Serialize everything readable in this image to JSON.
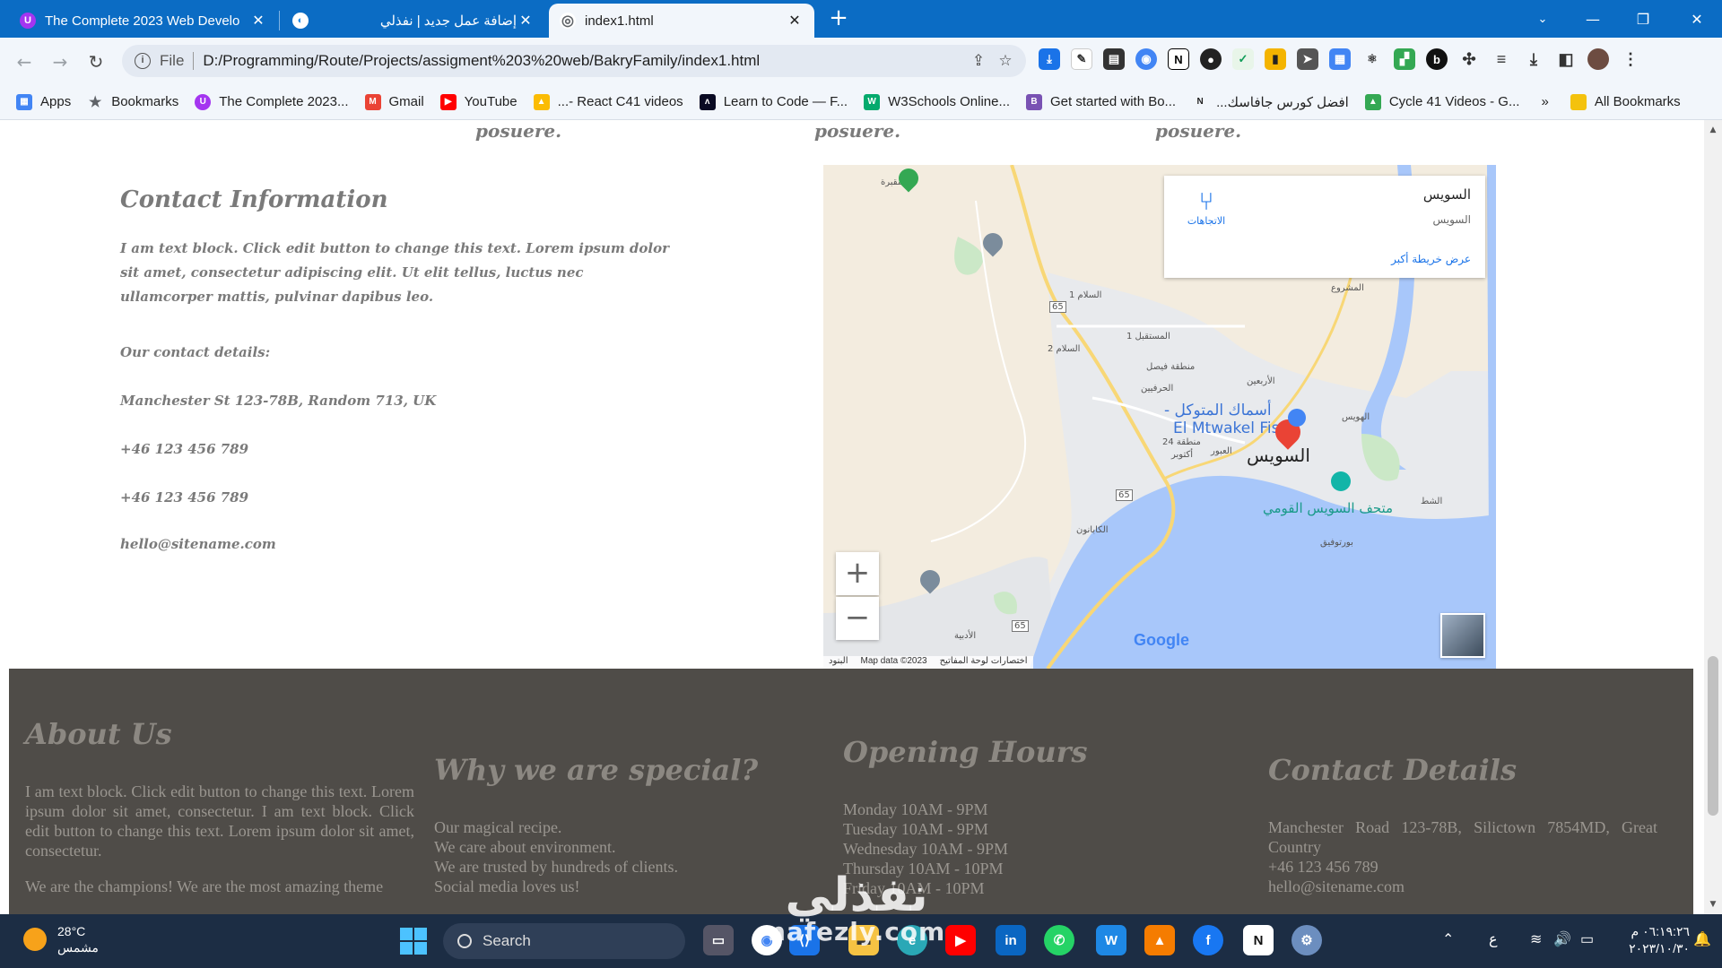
{
  "browser": {
    "tabs": [
      {
        "title": "The Complete 2023 Web Develo",
        "favicon_color": "#a435f0",
        "favicon_glyph": "U"
      },
      {
        "title": "إضافة عمل جديد | نفذلي",
        "favicon_color": "#1e88e5",
        "favicon_glyph": "◐"
      },
      {
        "title": "index1.html",
        "favicon_color": "#5f6368",
        "favicon_glyph": "◎"
      }
    ],
    "close_glyph": "✕",
    "new_tab_glyph": "+",
    "url_scheme_label": "File",
    "url": "D:/Programming/Route/Projects/assigment%203%20web/BakryFamily/index1.html",
    "bookmarks": [
      {
        "label": "Apps",
        "icon": "apps-grid-icon",
        "color": "#4285f4"
      },
      {
        "label": "Bookmarks",
        "icon": "star-icon",
        "color": "#5f6368"
      },
      {
        "label": "The Complete 2023...",
        "icon": "udemy-icon",
        "color": "#a435f0"
      },
      {
        "label": "Gmail",
        "icon": "gmail-icon",
        "color": "#ea4335"
      },
      {
        "label": "YouTube",
        "icon": "youtube-icon",
        "color": "#ff0000"
      },
      {
        "label": "...- React C41 videos",
        "icon": "drive-icon",
        "color": "#fbbc04"
      },
      {
        "label": "Learn to Code — F...",
        "icon": "freecodecamp-icon",
        "color": "#0a0a23"
      },
      {
        "label": "W3Schools Online...",
        "icon": "w3schools-icon",
        "color": "#04aa6d"
      },
      {
        "label": "Get started with Bo...",
        "icon": "bootstrap-icon",
        "color": "#7952b3"
      },
      {
        "label": "افضل كورس جافاسك...",
        "icon": "notion-icon",
        "color": "#222222"
      },
      {
        "label": "Cycle 41 Videos - G...",
        "icon": "drive-icon",
        "color": "#34a853"
      }
    ],
    "bookmarks_more": "»",
    "all_bookmarks": "All Bookmarks"
  },
  "page": {
    "posuere": [
      "posuere.",
      "posuere.",
      "posuere."
    ],
    "contact": {
      "heading": "Contact Information",
      "intro": "I am text block. Click edit button to change this text. Lorem ipsum dolor sit amet, consectetur adipiscing elit. Ut elit tellus, luctus nec ullamcorper mattis, pulvinar dapibus leo.",
      "details_label": "Our contact details:",
      "address": "Manchester St 123-78B, Random 713, UK",
      "phone1": "+46 123 456 789",
      "phone2": "+46 123 456 789",
      "email": "hello@sitename.com"
    },
    "map": {
      "place_name": "السويس",
      "place_address": "السويس",
      "larger_map": "عرض خريطة أكبر",
      "directions": "الاتجاهات",
      "zoom_in": "+",
      "zoom_out": "−",
      "city_label": "السويس",
      "restaurant_label_ar": "- أسماك المتوكل",
      "restaurant_label_en": "El Mtwakel Fis",
      "museum_label": "متحف السويس القومي",
      "google": "Google",
      "footer_data": "Map data ©2023",
      "footer_shortcuts": "اختصارات لوحة المفاتيح",
      "footer_terms": "البنود",
      "labels": {
        "cemetery": "مقبرة",
        "salam1": "السلام 1",
        "salam2": "السلام 2",
        "mostakbal": "المستقبل 1",
        "faisal": "منطقة فيصل",
        "herafyeen": "الحرفيين",
        "arbaeen": "الأربعين",
        "el_hawees": "الهويس",
        "zone24": "منطقة 24",
        "october": "أكتوبر",
        "obour": "العبور",
        "shatt": "الشط",
        "kabanon": "الكابانون",
        "port_tawfik": "بورتوفيق",
        "adabiya": "الأدبية",
        "mashroo": "المشروع",
        "r65": "65"
      }
    },
    "footer": {
      "about": {
        "heading": "About Us",
        "p1": "I am text block. Click edit button to change this text. Lorem ipsum dolor sit amet, consectetur. I am text block. Click edit button to change this text. Lorem ipsum dolor sit amet, consectetur.",
        "p2": "We are the champions! We are the most amazing theme"
      },
      "special": {
        "heading": "Why we are special?",
        "items": [
          "Our magical recipe.",
          "We care about environment.",
          "We are trusted by hundreds of clients.",
          "Social media loves us!"
        ]
      },
      "hours": {
        "heading": "Opening Hours",
        "items": [
          "Monday 10AM - 9PM",
          "Tuesday 10AM - 9PM",
          "Wednesday 10AM - 9PM",
          "Thursday 10AM - 10PM",
          "Friday 10AM - 10PM"
        ]
      },
      "contact": {
        "heading": "Contact Details",
        "address": "Manchester Road 123-78B, Silictown 7854MD, Great Country",
        "phone": "+46 123 456 789",
        "email": "hello@sitename.com"
      }
    }
  },
  "taskbar": {
    "temperature": "28°C",
    "weather_text": "مشمس",
    "search_placeholder": "Search",
    "clock_time": "٠٦:١٩:٢٦ م",
    "clock_date": "٢٠٢٣/١٠/٣٠",
    "lang": "ع",
    "watermark_ar": "نفذلي",
    "watermark_en": "nafezly.com"
  }
}
